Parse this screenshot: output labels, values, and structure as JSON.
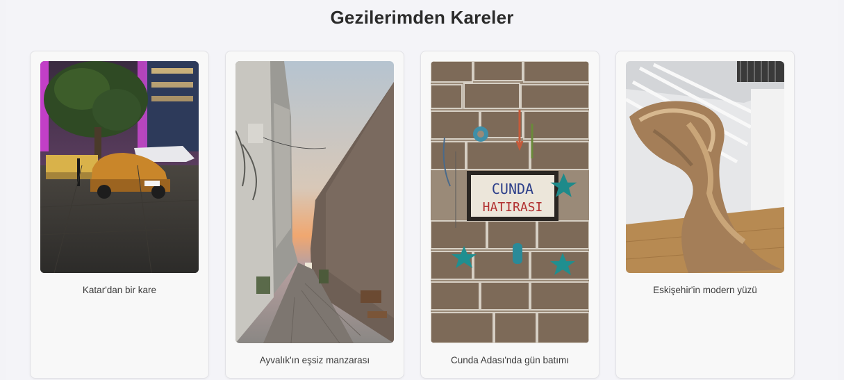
{
  "gallery": {
    "title": "Gezilerimden Kareler",
    "cards": [
      {
        "caption": "Katar'dan bir kare",
        "photo": "car-night-street-photo"
      },
      {
        "caption": "Ayvalık'ın eşsiz manzarası",
        "photo": "alley-sunset-photo"
      },
      {
        "caption": "Cunda Adası'nda gün batımı",
        "photo": "stone-wall-sign-photo"
      },
      {
        "caption": "Eskişehir'in modern yüzü",
        "photo": "sculpture-museum-photo"
      }
    ],
    "sign": {
      "line1": "CUNDA",
      "line2": "HATIRASI"
    }
  }
}
